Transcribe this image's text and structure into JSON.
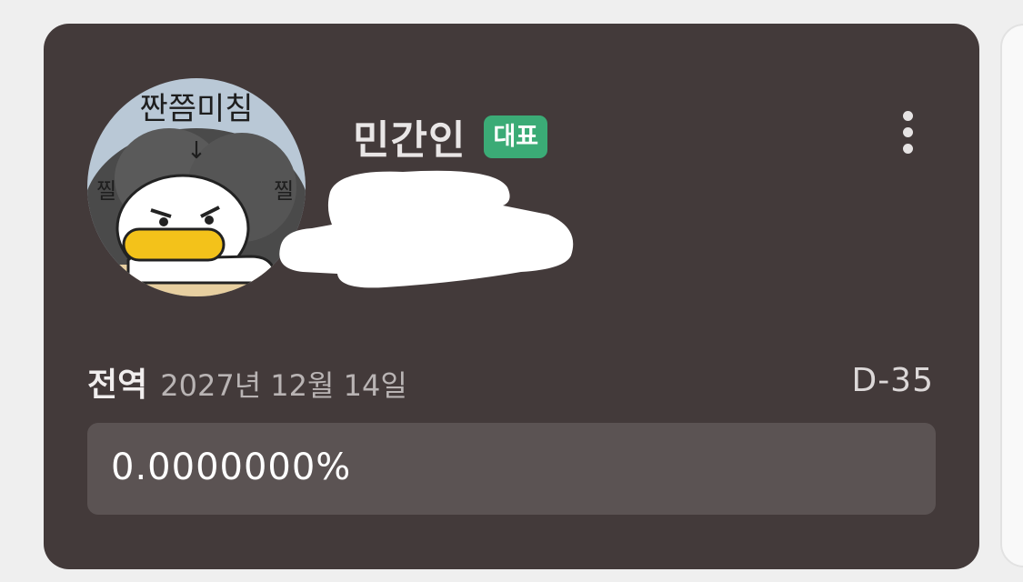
{
  "profile": {
    "name": "민간인",
    "badge": "대표",
    "avatar_icon": "duck-character-icon",
    "avatar_text": {
      "top": "짠쯤미침",
      "arrow": "↓",
      "left_side": "찔",
      "right_side": "찔"
    }
  },
  "service": {
    "label": "전역",
    "date": "2027년 12월 14일",
    "dday": "D-35",
    "progress_text": "0.0000000%",
    "progress_fraction": 0.0
  },
  "menu": {
    "icon": "more-vertical-icon"
  },
  "colors": {
    "card_bg": "#433a3a",
    "badge_bg": "#3bab76",
    "progress_bg": "#5b5353"
  }
}
